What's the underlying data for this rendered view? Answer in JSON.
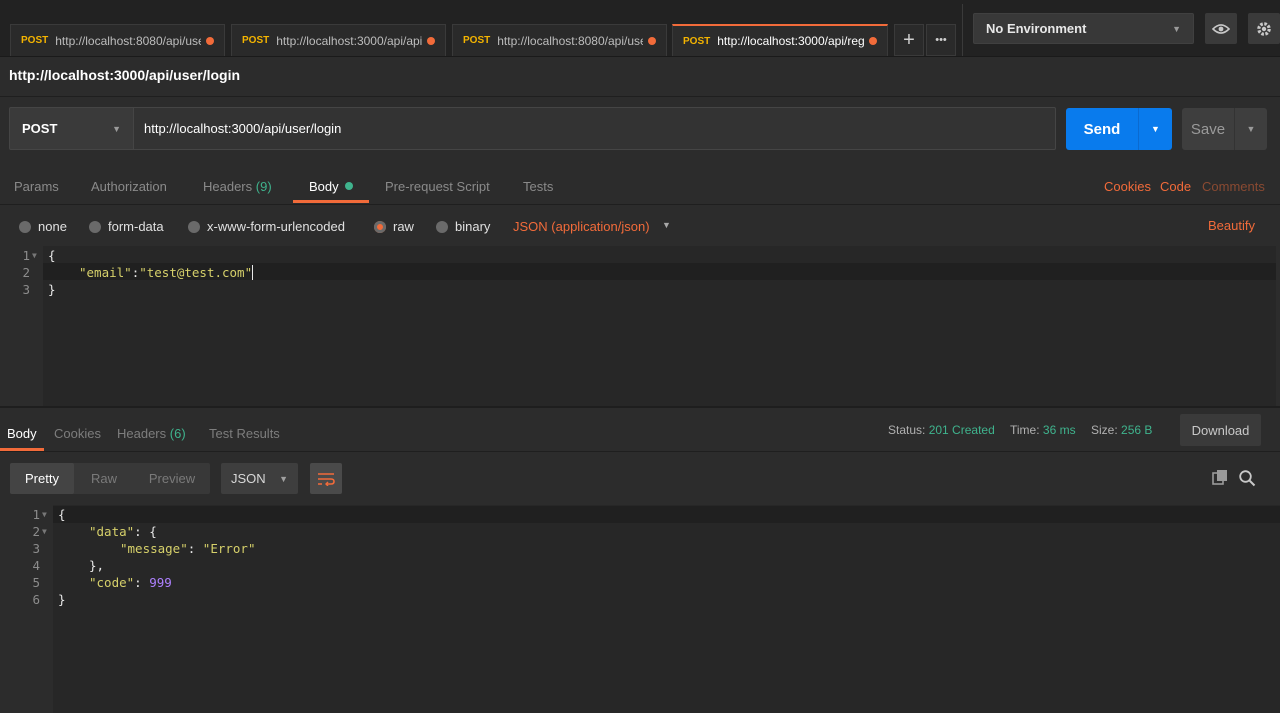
{
  "tabs": [
    {
      "method": "POST",
      "url": "http://localhost:8080/api/user",
      "active": false
    },
    {
      "method": "POST",
      "url": "http://localhost:3000/api/api",
      "active": false
    },
    {
      "method": "POST",
      "url": "http://localhost:8080/api/use",
      "active": false
    },
    {
      "method": "POST",
      "url": "http://localhost:3000/api/reg",
      "active": true
    }
  ],
  "tabbar": {
    "add_icon": "+",
    "more_icon": "•••"
  },
  "environment": {
    "selected": "No Environment"
  },
  "request": {
    "title": "http://localhost:3000/api/user/login",
    "method": "POST",
    "url": "http://localhost:3000/api/user/login",
    "send_label": "Send",
    "save_label": "Save"
  },
  "request_tabs": {
    "params": "Params",
    "authorization": "Authorization",
    "headers": "Headers",
    "headers_count": "(9)",
    "body": "Body",
    "prerequest": "Pre-request Script",
    "tests": "Tests",
    "cookies": "Cookies",
    "code": "Code",
    "comments": "Comments"
  },
  "body_modes": {
    "none": "none",
    "form_data": "form-data",
    "urlencoded": "x-www-form-urlencoded",
    "raw": "raw",
    "binary": "binary",
    "type": "JSON (application/json)",
    "beautify": "Beautify"
  },
  "request_body": {
    "line_numbers": [
      "1",
      "2",
      "3"
    ],
    "line1": "{",
    "line2_key": "\"email\"",
    "line2_colon": ":",
    "line2_value": "\"test@test.com\"",
    "line3": "}"
  },
  "response_tabs": {
    "body": "Body",
    "cookies": "Cookies",
    "headers": "Headers",
    "headers_count": "(6)",
    "test_results": "Test Results"
  },
  "response_status": {
    "status_label": "Status:",
    "status_value": "201 Created",
    "time_label": "Time:",
    "time_value": "36 ms",
    "size_label": "Size:",
    "size_value": "256 B",
    "download": "Download"
  },
  "response_view": {
    "pretty": "Pretty",
    "raw": "Raw",
    "preview": "Preview",
    "format": "JSON"
  },
  "response_body": {
    "line_numbers": [
      "1",
      "2",
      "3",
      "4",
      "5",
      "6"
    ],
    "l1": "{",
    "l2_key": "\"data\"",
    "l2_rest": ": {",
    "l3_key": "\"message\"",
    "l3_colon": ": ",
    "l3_value": "\"Error\"",
    "l4": "},",
    "l5_key": "\"code\"",
    "l5_colon": ": ",
    "l5_value": "999",
    "l6": "}"
  }
}
